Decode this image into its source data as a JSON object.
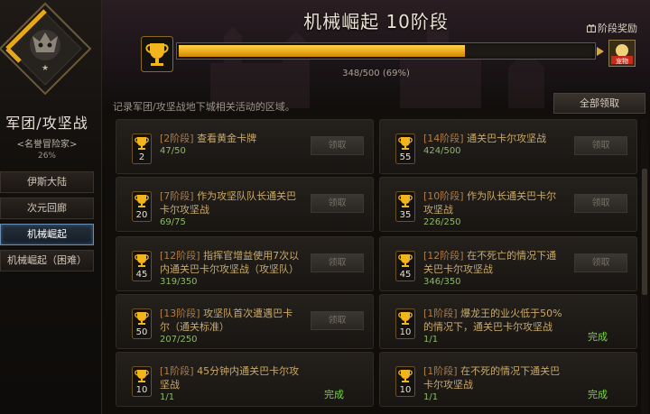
{
  "sidebar": {
    "title": "军团/攻坚战",
    "subtitle": "<名誉冒险家>",
    "percent": "26%",
    "items": [
      {
        "label": "伊斯大陆",
        "active": false
      },
      {
        "label": "次元回廊",
        "active": false
      },
      {
        "label": "机械崛起",
        "active": true
      },
      {
        "label": "机械崛起（困难）",
        "active": false
      }
    ]
  },
  "header": {
    "title": "机械崛起 10阶段",
    "stage_reward": "阶段奖励",
    "progress_current": 348,
    "progress_total": 500,
    "progress_text": "348/500 (69%)",
    "progress_fraction": 0.69,
    "reward_icon_label": "宠物"
  },
  "description": "记录军团/攻坚战地下城相关活动的区域。",
  "claim_all_label": "全部领取",
  "achievements": [
    {
      "num": "2",
      "stage": "[2阶段]",
      "text": "查看黄金卡牌",
      "progress": "47/50",
      "status": "领取",
      "complete": false
    },
    {
      "num": "55",
      "stage": "[14阶段]",
      "text": "通关巴卡尔攻坚战",
      "progress": "424/500",
      "status": "领取",
      "complete": false
    },
    {
      "num": "20",
      "stage": "[7阶段]",
      "text": "作为攻坚队队长通关巴卡尔攻坚战",
      "progress": "69/75",
      "status": "领取",
      "complete": false
    },
    {
      "num": "35",
      "stage": "[10阶段]",
      "text": "作为队长通关巴卡尔攻坚战",
      "progress": "226/250",
      "status": "领取",
      "complete": false
    },
    {
      "num": "45",
      "stage": "[12阶段]",
      "text": "指挥官增益使用7次以内通关巴卡尔攻坚战（攻坚队）",
      "progress": "319/350",
      "status": "领取",
      "complete": false
    },
    {
      "num": "45",
      "stage": "[12阶段]",
      "text": "在不死亡的情况下通关巴卡尔攻坚战",
      "progress": "346/350",
      "status": "领取",
      "complete": false
    },
    {
      "num": "50",
      "stage": "[13阶段]",
      "text": "攻坚队首次遭遇巴卡尔（通关标准）",
      "progress": "207/250",
      "status": "领取",
      "complete": false
    },
    {
      "num": "10",
      "stage": "[1阶段]",
      "text": "爆龙王的业火低于50%的情况下，通关巴卡尔攻坚战",
      "progress": "1/1",
      "status": "完成",
      "complete": true
    },
    {
      "num": "10",
      "stage": "[1阶段]",
      "text": "45分钟内通关巴卡尔攻坚战",
      "progress": "1/1",
      "status": "完成",
      "complete": true
    },
    {
      "num": "10",
      "stage": "[1阶段]",
      "text": "在不死的情况下通关巴卡尔攻坚战",
      "progress": "1/1",
      "status": "完成",
      "complete": true
    }
  ],
  "colors": {
    "accent_gold": "#f2b51e",
    "complete_green": "#7bd34a",
    "progress_green": "#8fb76a",
    "active_tab_border": "#6a8fb6"
  },
  "icons": [
    "emblem-icon",
    "gift-icon",
    "trophy-icon",
    "arrow-right-icon",
    "reward-pet-icon"
  ]
}
